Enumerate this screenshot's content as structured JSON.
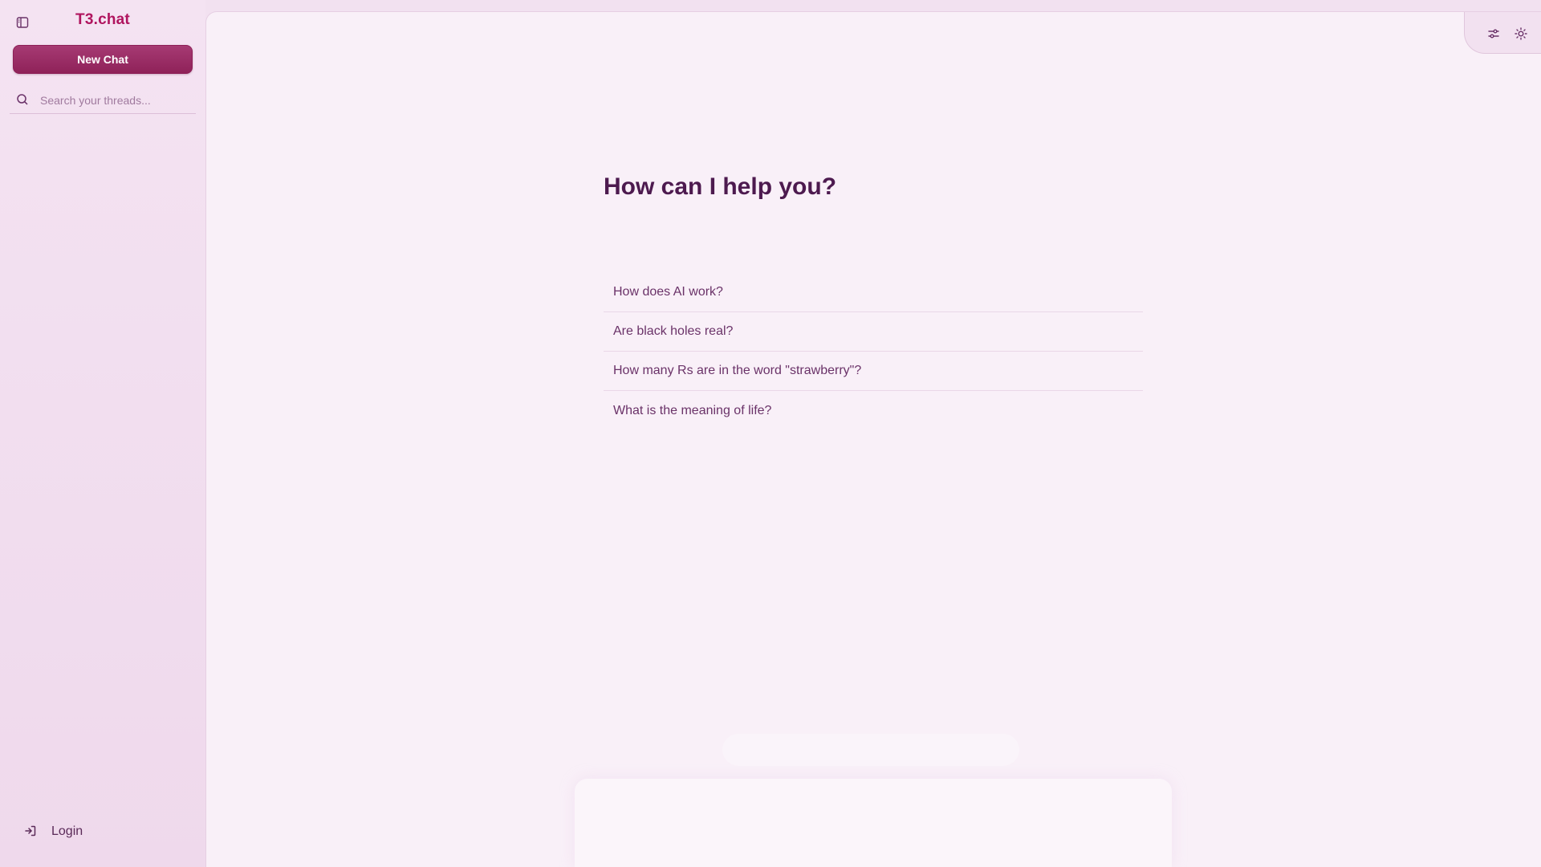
{
  "app": {
    "logo": "T3.chat"
  },
  "sidebar": {
    "new_chat_label": "New Chat",
    "search_placeholder": "Search your threads...",
    "login_label": "Login"
  },
  "main": {
    "headline": "How can I help you?",
    "suggestions": [
      "How does AI work?",
      "Are black holes real?",
      "How many Rs are in the word \"strawberry\"?",
      "What is the meaning of life?"
    ]
  },
  "icons": {
    "sidebar_toggle": "sidebar-panel-icon",
    "search": "search-icon",
    "login": "login-icon",
    "settings": "sliders-icon",
    "theme": "sun-icon"
  },
  "colors": {
    "accent": "#b0155f",
    "button": "#a63a73",
    "text": "#4d1a4f"
  }
}
